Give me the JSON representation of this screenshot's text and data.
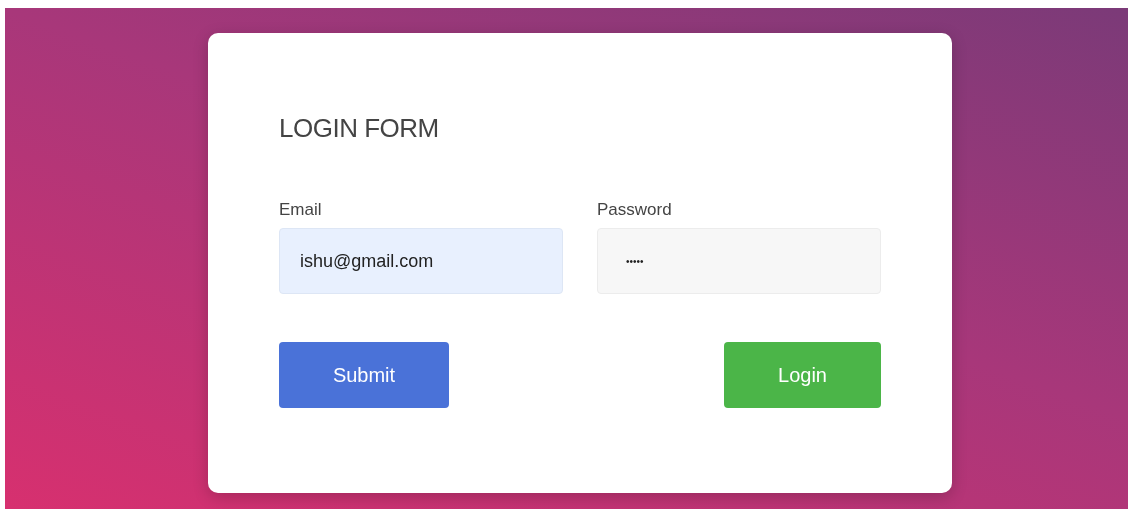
{
  "form": {
    "title": "LOGIN FORM",
    "fields": [
      {
        "label": "Email",
        "value": "ishu@gmail.com",
        "kind": "email"
      },
      {
        "label": "Password",
        "value": "•••••",
        "kind": "password"
      }
    ],
    "buttons": [
      {
        "label": "Submit",
        "kind": "submit"
      },
      {
        "label": "Login",
        "kind": "login"
      }
    ]
  }
}
